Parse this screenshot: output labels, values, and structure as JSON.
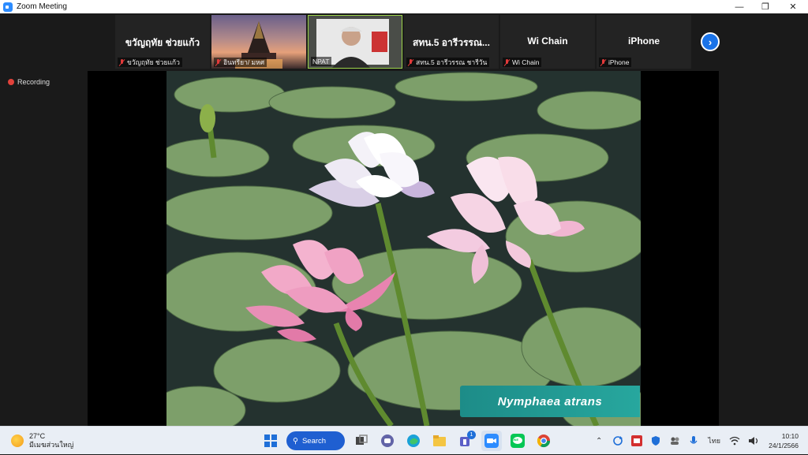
{
  "window": {
    "title": "Zoom Meeting"
  },
  "participants": [
    {
      "big_name": "ขวัญฤทัย ช่วยแก้ว",
      "label": "ขวัญฤทัย ช่วยแก้ว",
      "video": false
    },
    {
      "big_name": "",
      "label": "อินทรียา/ มหศ",
      "video": true
    },
    {
      "big_name": "",
      "label": "NPAT",
      "video": true
    },
    {
      "big_name": "สทน.5 อารีวรรณ...",
      "label": "สทน.5 อารีวรรณ ชารีวัน",
      "video": false
    },
    {
      "big_name": "Wi Chain",
      "label": "Wi Chain",
      "video": false
    },
    {
      "big_name": "iPhone",
      "label": "iPhone",
      "video": false
    }
  ],
  "recording": {
    "label": "Recording"
  },
  "slide": {
    "caption": "Nymphaea  atrans"
  },
  "taskbar": {
    "weather_temp": "27°C",
    "weather_desc": "มีเมฆส่วนใหญ่",
    "search_label": "Search",
    "teams_badge": "1",
    "language": "ไทย",
    "time": "10:10",
    "date": "24/1/2566",
    "line_label": "LINE"
  },
  "colors": {
    "accent": "#2d8cff",
    "mute": "#e23a3a",
    "caption_bg": "#1d8c88",
    "active_speaker": "#9cd34a"
  }
}
